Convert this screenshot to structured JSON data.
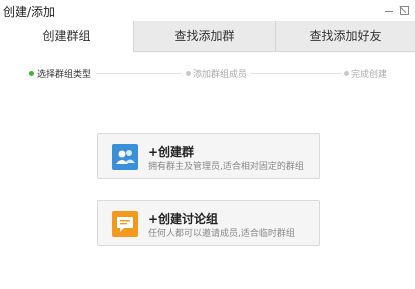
{
  "window": {
    "title": "创建/添加",
    "minimize_icon": "minimize-icon",
    "maximize_icon": "maximize-icon"
  },
  "tabs": [
    {
      "label": "创建群组",
      "active": true
    },
    {
      "label": "查找添加群",
      "active": false
    },
    {
      "label": "查找添加好友",
      "active": false
    }
  ],
  "steps": [
    {
      "label": "选择群组类型",
      "active": true
    },
    {
      "label": "添加群组成员",
      "active": false
    },
    {
      "label": "完成创建",
      "active": false
    }
  ],
  "options": [
    {
      "title": "+创建群",
      "description": "拥有群主及管理员,适合相对固定的群组",
      "icon": "group-icon",
      "color": "#3a8fd9"
    },
    {
      "title": "+创建讨论组",
      "description": "任何人都可以邀请成员,适合临时群组",
      "icon": "chat-icon",
      "color": "#f39a1e"
    }
  ]
}
